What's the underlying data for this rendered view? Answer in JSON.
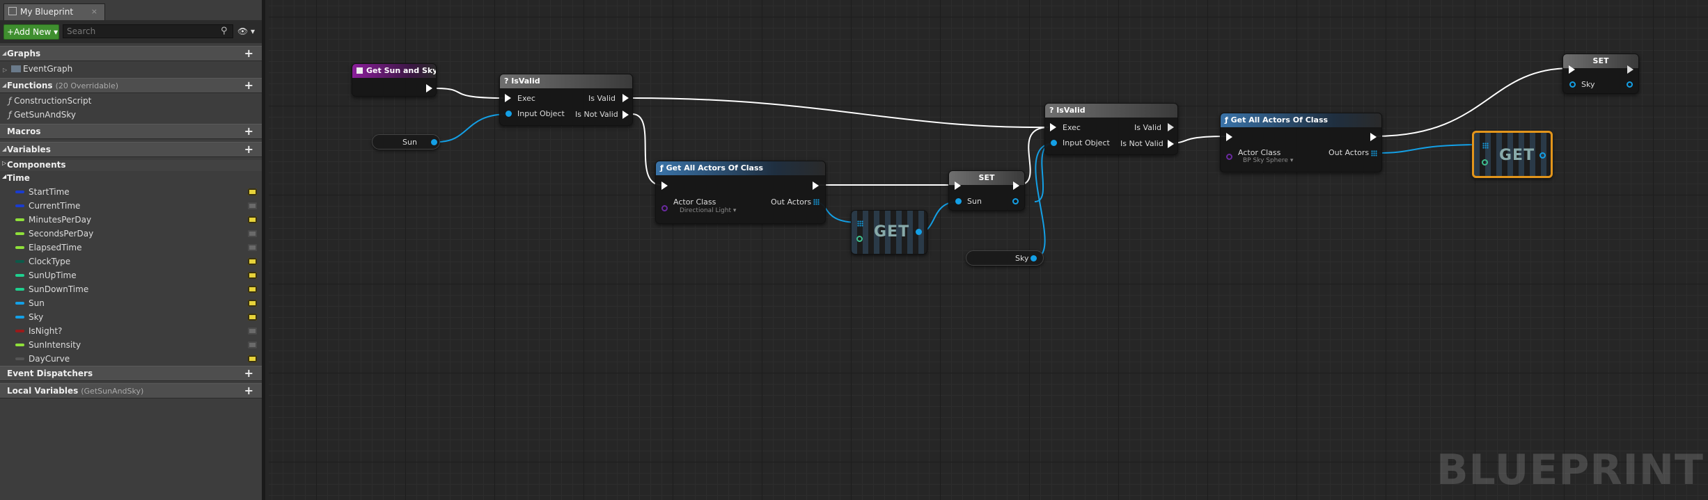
{
  "tab": {
    "title": "My Blueprint",
    "close": "×"
  },
  "toolbar": {
    "add_new": "+Add New ▾",
    "search_placeholder": "Search",
    "search_icon": "magnifier-icon",
    "view_icon": "👁 ▾"
  },
  "sections": {
    "graphs": "Graphs",
    "functions": "Functions",
    "functions_sub": "(20 Overridable)",
    "macros": "Macros",
    "variables": "Variables",
    "components": "Components",
    "time": "Time",
    "event_dispatchers": "Event Dispatchers",
    "local_variables": "Local Variables",
    "local_variables_sub": "(GetSunAndSky)"
  },
  "graphs": [
    {
      "label": "EventGraph"
    }
  ],
  "functions": [
    {
      "label": "ConstructionScript"
    },
    {
      "label": "GetSunAndSky"
    }
  ],
  "variables": [
    {
      "label": "StartTime",
      "color": "#1a3ccf",
      "public": true
    },
    {
      "label": "CurrentTime",
      "color": "#1a3ccf",
      "public": false
    },
    {
      "label": "MinutesPerDay",
      "color": "#8fe03a",
      "public": true
    },
    {
      "label": "SecondsPerDay",
      "color": "#8fe03a",
      "public": false
    },
    {
      "label": "ElapsedTime",
      "color": "#8fe03a",
      "public": false
    },
    {
      "label": "ClockType",
      "color": "#0d5a4a",
      "public": true
    },
    {
      "label": "SunUpTime",
      "color": "#1fd08f",
      "public": true
    },
    {
      "label": "SunDownTime",
      "color": "#1fd08f",
      "public": true
    },
    {
      "label": "Sun",
      "color": "#14a0e6",
      "public": true
    },
    {
      "label": "Sky",
      "color": "#14a0e6",
      "public": true
    },
    {
      "label": "IsNight?",
      "color": "#9a1a1a",
      "public": false
    },
    {
      "label": "SunIntensity",
      "color": "#8fe03a",
      "public": false
    },
    {
      "label": "DayCurve",
      "color": "#555555",
      "public": true
    }
  ],
  "nodes": {
    "entry": {
      "title": "Get Sun and Sky"
    },
    "isvalid1": {
      "title": "? IsValid",
      "exec": "Exec",
      "input": "Input Object",
      "valid": "Is Valid",
      "notvalid": "Is Not Valid"
    },
    "sun_get": {
      "label": "Sun"
    },
    "getall1": {
      "title": "ƒ Get All Actors Of Class",
      "class": "Actor Class",
      "class_value": "Directional Light ▾",
      "out": "Out Actors"
    },
    "get1": {
      "label": "GET"
    },
    "set_sun": {
      "title": "SET",
      "var": "Sun"
    },
    "sky_get": {
      "label": "Sky"
    },
    "isvalid2": {
      "title": "? IsValid",
      "exec": "Exec",
      "input": "Input Object",
      "valid": "Is Valid",
      "notvalid": "Is Not Valid"
    },
    "getall2": {
      "title": "ƒ Get All Actors Of Class",
      "class": "Actor Class",
      "class_value": "BP Sky Sphere ▾",
      "out": "Out Actors"
    },
    "get2": {
      "label": "GET"
    },
    "set_sky": {
      "title": "SET",
      "var": "Sky"
    }
  },
  "watermark": "BLUEPRINT"
}
